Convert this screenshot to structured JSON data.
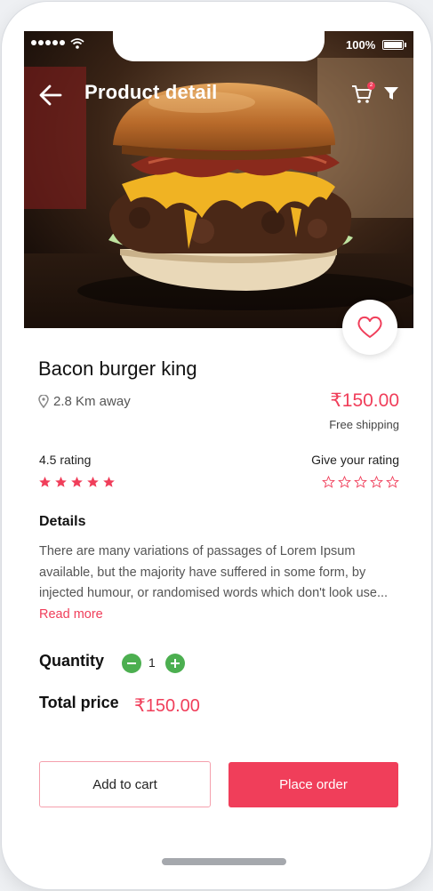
{
  "status_bar": {
    "battery": "100%"
  },
  "header": {
    "title": "Product detail",
    "cart_badge": "2"
  },
  "product": {
    "name": "Bacon burger king",
    "distance": "2.8 Km away",
    "price": "₹150.00",
    "shipping": "Free shipping"
  },
  "rating": {
    "label": "4.5 rating",
    "stars": 5,
    "give_label": "Give your rating",
    "give_stars": 5
  },
  "details": {
    "heading": "Details",
    "text": "There are many variations of passages of Lorem Ipsum available, but the majority have suffered  in some form, by injected humour, or randomised words which don't look use... ",
    "read_more": "Read more"
  },
  "quantity": {
    "label": "Quantity",
    "value": "1"
  },
  "total": {
    "label": "Total price",
    "value": "₹150.00"
  },
  "actions": {
    "add_to_cart": "Add to cart",
    "place_order": "Place order"
  },
  "colors": {
    "accent": "#f03e5a",
    "quantity_button": "#4caf50"
  }
}
